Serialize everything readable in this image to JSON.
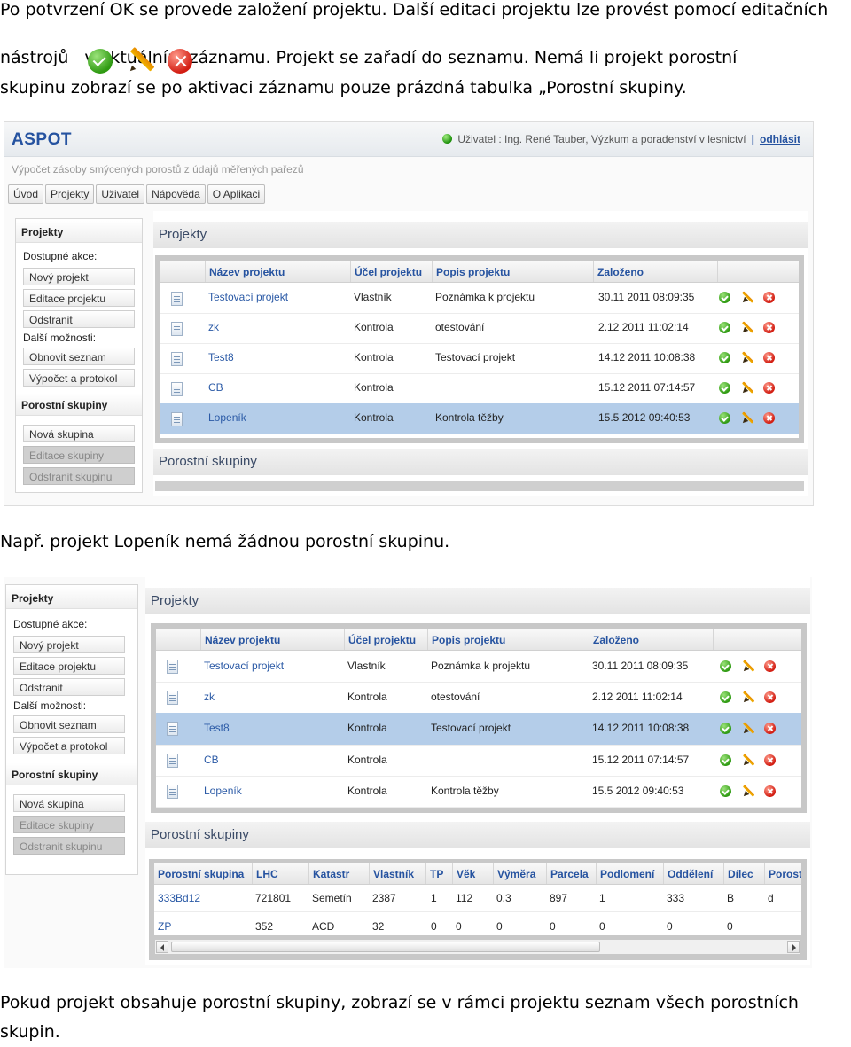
{
  "intro": {
    "line1": "Po potvrzení OK se provede založení projektu. Další editaci projektu lze provést pomocí  editačních",
    "line2a": "nástrojů",
    "line2b": "v aktuálním záznamu. Projekt se zařadí do seznamu. Nemá li projekt porostní",
    "line3": "skupinu zobrazí se po aktivaci záznamu pouze prázdná tabulka „Porostní skupiny."
  },
  "middle_text": "Např. projekt Lopeník nemá žádnou porostní skupinu.",
  "outro": {
    "line1": "Pokud projekt obsahuje porostní skupiny, zobrazí se v rámci projektu seznam všech porostních",
    "line2": "skupin."
  },
  "app": {
    "logo": "ASPOT",
    "user_text": "Uživatel : Ing. René Tauber, Výzkum a poradenství v lesnictví",
    "logout": "odhlásit",
    "subtitle": "Výpočet zásoby smýcených porostů z údajů měřených pařezů",
    "menu": [
      "Úvod",
      "Projekty",
      "Uživatel",
      "Nápověda",
      "O Aplikaci"
    ]
  },
  "sidebar": {
    "projects_head": "Projekty",
    "actions_label": "Dostupné akce:",
    "new_project": "Nový projekt",
    "edit_project": "Editace projektu",
    "remove": "Odstranit",
    "more_label": "Další možnosti:",
    "refresh": "Obnovit seznam",
    "calc": "Výpočet a protokol",
    "groups_head": "Porostní skupiny",
    "new_group": "Nová skupina",
    "edit_group": "Editace skupiny",
    "remove_group": "Odstranit skupinu"
  },
  "projects_panel": {
    "title": "Projekty",
    "columns": [
      "Název projektu",
      "Účel projektu",
      "Popis projektu",
      "Založeno"
    ],
    "rows": [
      [
        "Testovací projekt",
        "Vlastník",
        "Poznámka k projektu",
        "30.11 2011 08:09:35"
      ],
      [
        "zk",
        "Kontrola",
        "otestování",
        "2.12 2011 11:02:14"
      ],
      [
        "Test8",
        "Kontrola",
        "Testovací projekt",
        "14.12 2011 10:08:38"
      ],
      [
        "CB",
        "Kontrola",
        "",
        "15.12 2011 07:14:57"
      ],
      [
        "Lopeník",
        "Kontrola",
        "Kontrola těžby",
        "15.5 2012 09:40:53"
      ]
    ]
  },
  "groups_panel": {
    "title": "Porostní skupiny",
    "columns": [
      "Porostní skupina",
      "LHC",
      "Katastr",
      "Vlastník",
      "TP",
      "Věk",
      "Výměra",
      "Parcela",
      "Podlomení",
      "Oddělení",
      "Dílec",
      "Porost"
    ],
    "rows": [
      [
        "333Bd12",
        "721801",
        "Semetín",
        "2387",
        "1",
        "112",
        "0.3",
        "897",
        "1",
        "333",
        "B",
        "d"
      ],
      [
        "ZP",
        "352",
        "ACD",
        "32",
        "0",
        "0",
        "0",
        "0",
        "0",
        "0",
        "0",
        ""
      ]
    ]
  },
  "colors": {
    "accent": "#2653a0",
    "selected_row": "#b4cde9"
  }
}
